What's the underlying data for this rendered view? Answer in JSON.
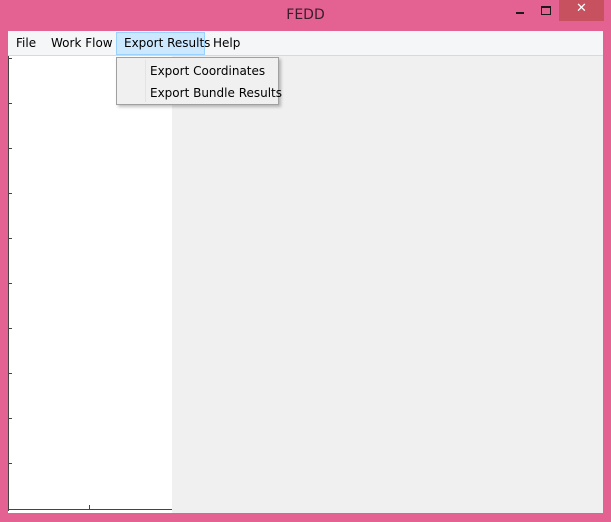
{
  "window": {
    "title": "FEDD",
    "frame_color": "#e36291",
    "controls": {
      "minimize": "minimize-icon",
      "maximize": "maximize-icon",
      "close": "close-icon",
      "close_glyph": "✕"
    }
  },
  "menubar": {
    "items": [
      {
        "label": "File"
      },
      {
        "label": "Work Flow"
      },
      {
        "label": "Export Results",
        "state": "open"
      },
      {
        "label": "Help"
      }
    ]
  },
  "dropdown": {
    "items": [
      {
        "label": "Export Coordinates"
      },
      {
        "label": "Export Bundle Results"
      }
    ]
  }
}
